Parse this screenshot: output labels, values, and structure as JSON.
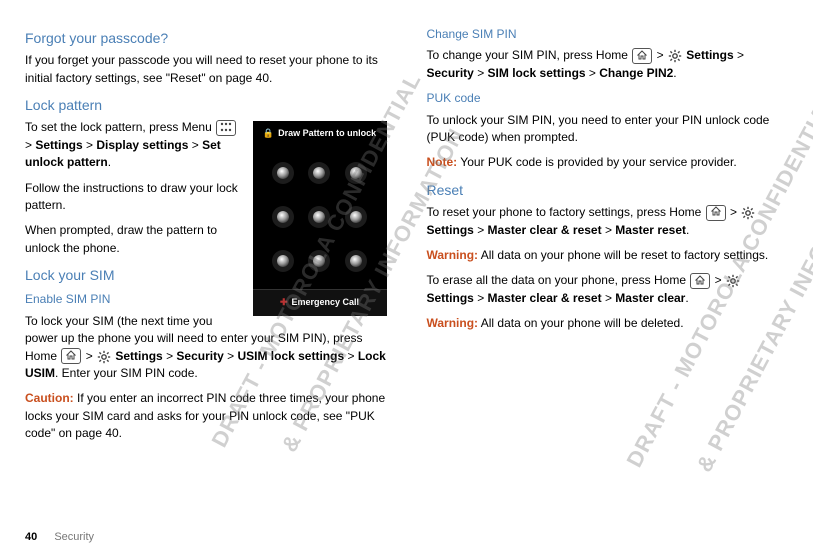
{
  "left": {
    "forgot": {
      "heading": "Forgot your passcode?",
      "body": "If you forget your passcode you will need to reset your phone to its initial factory settings, see \"Reset\" on page 40."
    },
    "lockPattern": {
      "heading": "Lock pattern",
      "p1a": "To set the lock pattern, press Menu ",
      "p1b": "> ",
      "settings": "Settings",
      "gt1": " > ",
      "displaySettings": "Display settings",
      "gt2": " > ",
      "setUnlock": "Set unlock pattern",
      "period": ".",
      "p2": "Follow the instructions to draw your lock pattern.",
      "p3": "When prompted, draw the pattern to unlock the phone."
    },
    "lockSim": {
      "heading": "Lock your SIM",
      "enableHeading": "Enable SIM PIN",
      "p1a": "To lock your SIM (the next time you power up the phone you will need to enter your SIM PIN), press Home ",
      "gt1": "> ",
      "settings": "Settings",
      "gt2": " > ",
      "security": "Security",
      "gt3": " > ",
      "usimLock": "USIM lock settings",
      "gt4": " > ",
      "lockUsim": "Lock USIM",
      "p1b": ". Enter your SIM PIN code.",
      "cautionLabel": "Caution:",
      "cautionText": " If you enter an incorrect PIN code three times, your phone locks your SIM card and asks for your PIN unlock code, see \"PUK code\" on page 40."
    },
    "lockScreen": {
      "title": "Draw Pattern to unlock",
      "emergency": "Emergency Call"
    }
  },
  "right": {
    "changePin": {
      "heading": "Change SIM PIN",
      "p1a": "To change your SIM PIN, press Home ",
      "gt1": "> ",
      "settings": "Settings",
      "gt2": " > ",
      "security": "Security",
      "gt3": " > ",
      "simLock": "SIM lock settings",
      "gt4": " > ",
      "changePin2": "Change PIN2",
      "period": "."
    },
    "puk": {
      "heading": "PUK code",
      "p1": "To unlock your SIM PIN, you need to enter your PIN unlock code (PUK code) when prompted.",
      "noteLabel": "Note:",
      "noteText": " Your PUK code is provided by your service provider."
    },
    "reset": {
      "heading": "Reset",
      "p1a": "To reset your phone to factory settings, press Home ",
      "gt1": "> ",
      "settings": "Settings",
      "gt2": " > ",
      "masterClear": "Master clear & reset",
      "gt3": " > ",
      "masterReset": "Master reset",
      "period": ".",
      "warn1Label": "Warning:",
      "warn1Text": " All data on your phone will be reset to factory settings.",
      "p2a": "To erase all the data on your phone, press Home ",
      "gt4": "> ",
      "settings2": "Settings",
      "gt5": " > ",
      "masterClear2": "Master clear & reset",
      "gt6": " > ",
      "masterClearOnly": "Master clear",
      "period2": ".",
      "warn2Label": "Warning:",
      "warn2Text": " All data on your phone will be deleted."
    }
  },
  "footer": {
    "page": "40",
    "section": "Security"
  },
  "watermark": {
    "line1": "DRAFT - MOTOROLA CONFIDENTIAL",
    "line2": "& PROPRIETARY INFORMATION"
  }
}
